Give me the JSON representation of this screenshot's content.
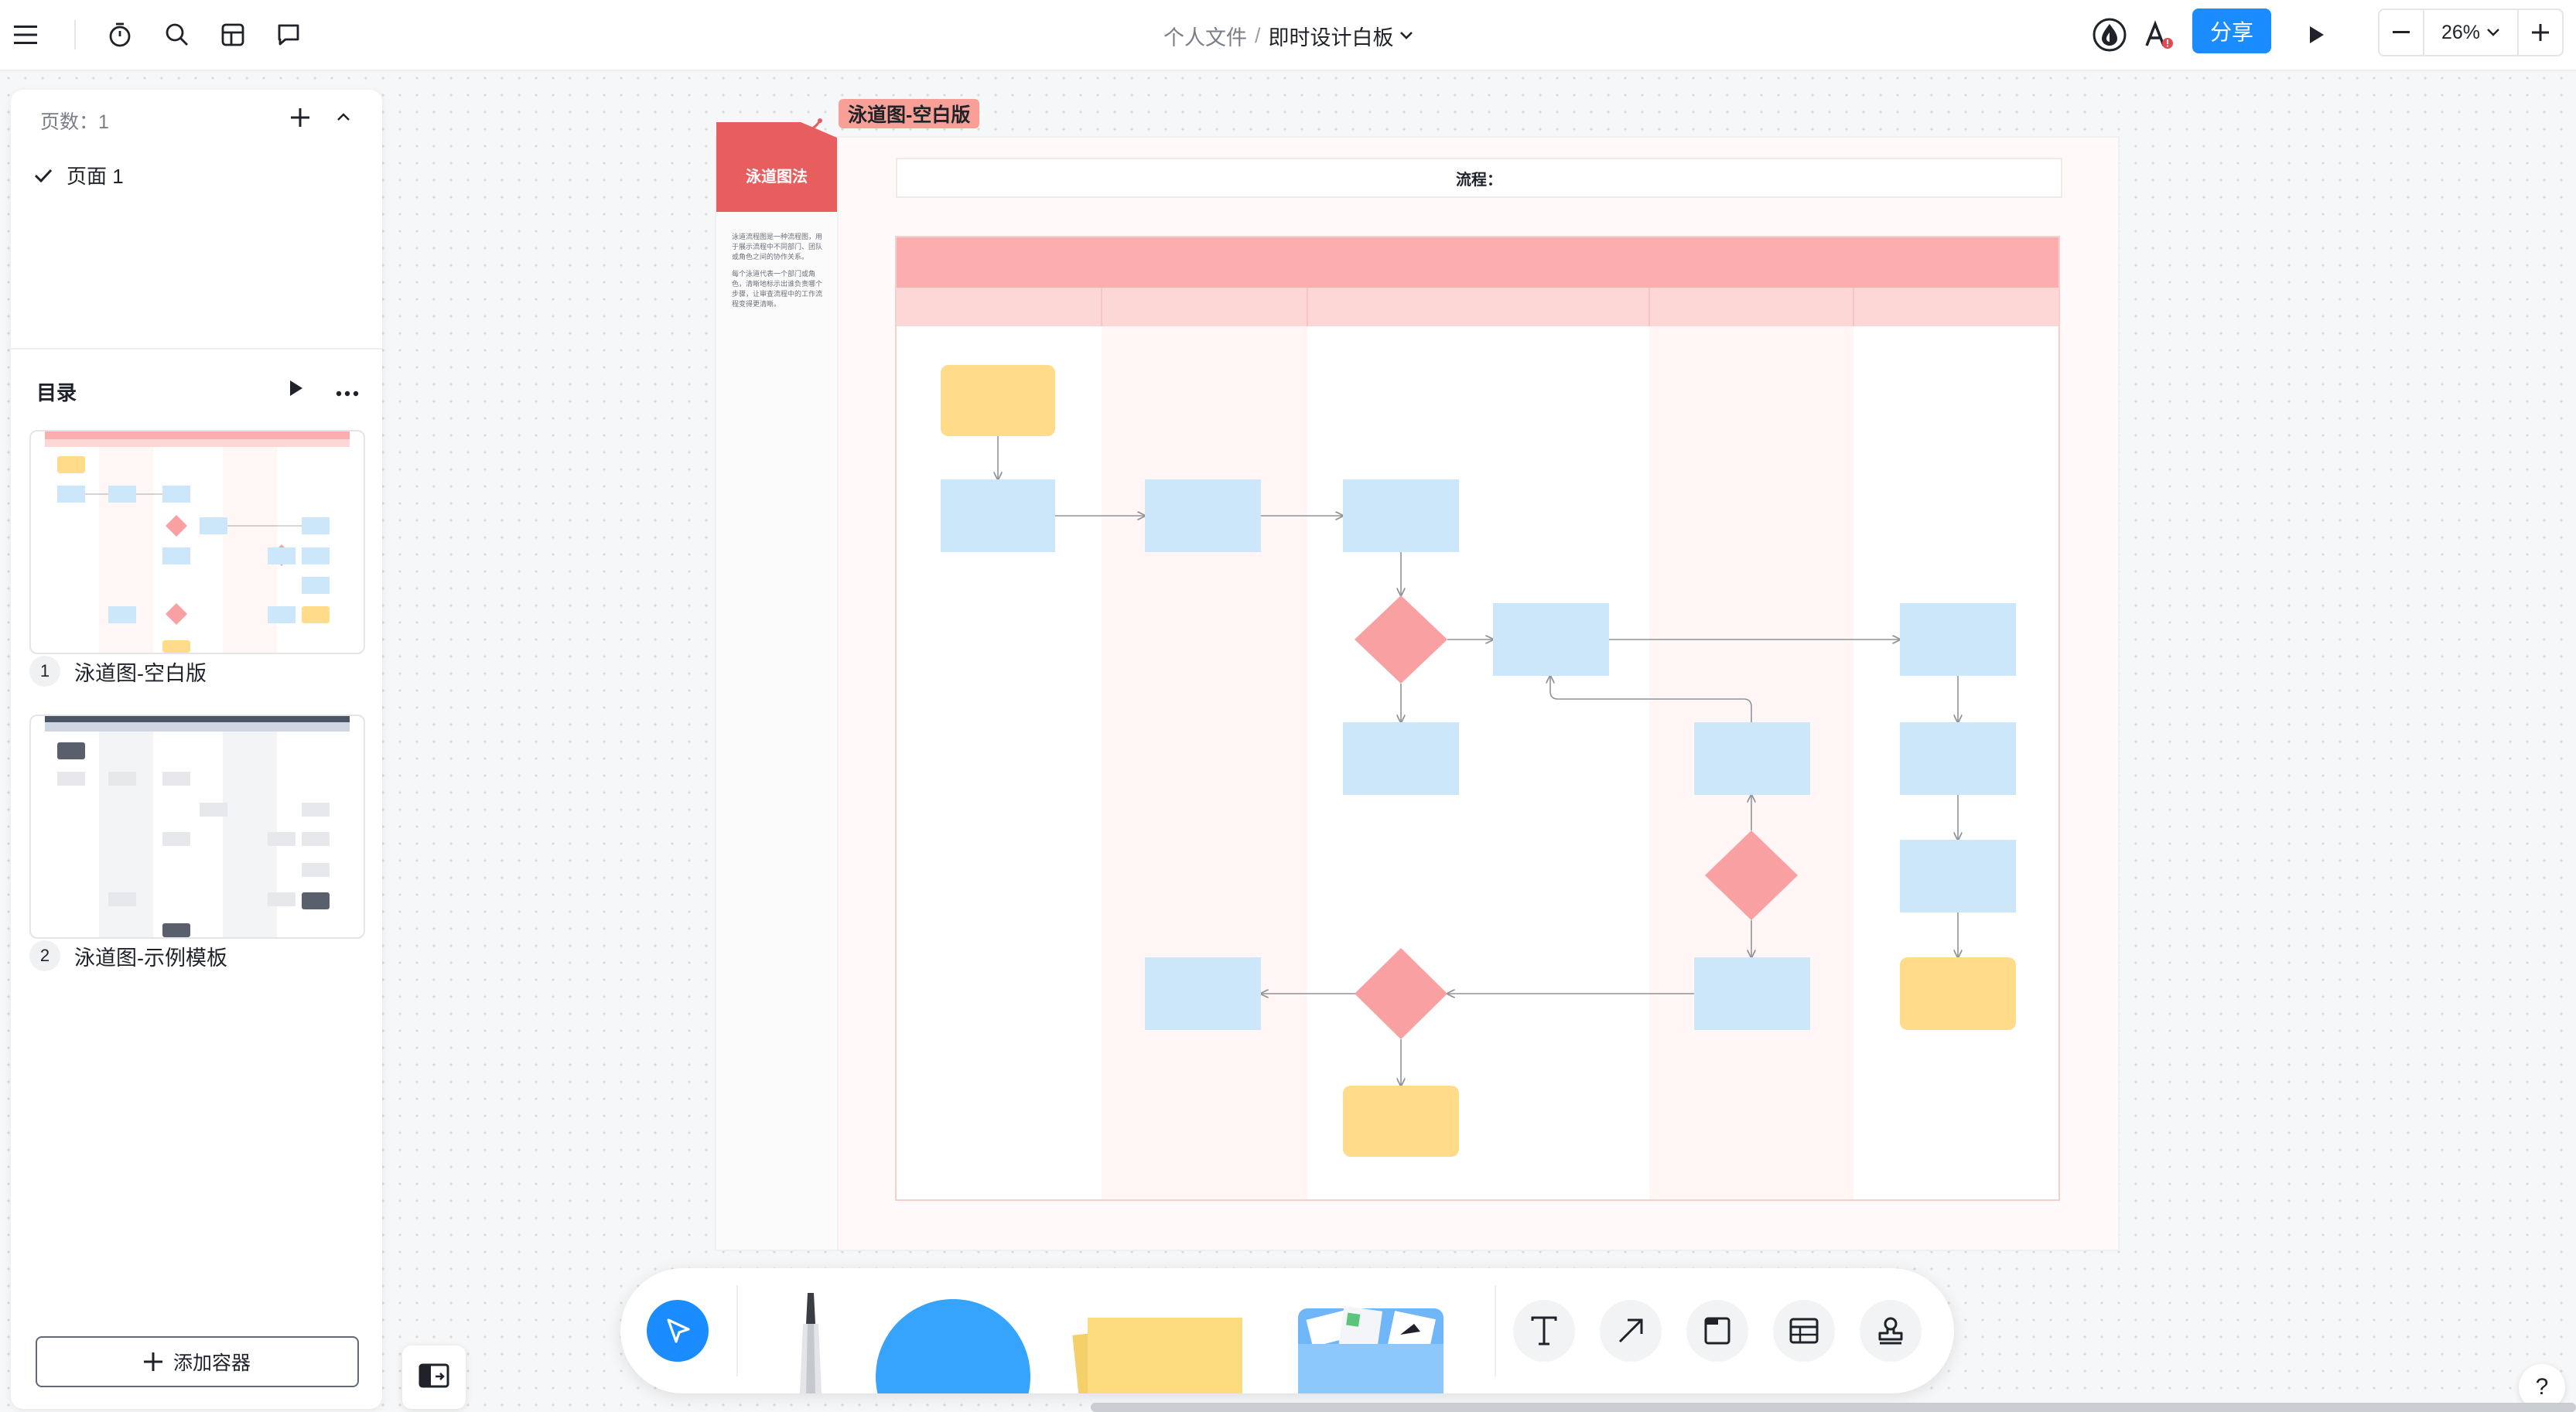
{
  "topbar": {
    "breadcrumb_folder": "个人文件",
    "breadcrumb_sep": "/",
    "doc_title": "即时设计白板",
    "share_label": "分享",
    "zoom_value": "26%",
    "zoom_minus": "−",
    "zoom_plus": "+"
  },
  "sidebar": {
    "pages_label": "页数：1",
    "pages": [
      {
        "label": "页面 1",
        "selected": true
      }
    ],
    "toc_label": "目录",
    "templates": [
      {
        "num": "1",
        "label": "泳道图-空白版"
      },
      {
        "num": "2",
        "label": "泳道图-示例模板"
      }
    ],
    "add_container_label": "添加容器"
  },
  "board": {
    "frame_label": "泳道图-空白版",
    "tab_title": "泳道图法",
    "desc_para1": "泳道流程图是一种流程图，用于展示流程中不同部门、团队或角色之间的协作关系。",
    "desc_para2": "每个泳道代表一个部门或角色，清晰地标示出谁负责哪个步骤，让审查流程中的工作流程变得更清晰。",
    "process_label": "流程：",
    "colors": {
      "header_band": "#fcaeae",
      "subheader_band": "#fdd6d6",
      "process": "#cce6fa",
      "terminal": "#ffdb8a",
      "decision": "#f9a0a3",
      "tab": "#e85d5d"
    }
  },
  "help_label": "?"
}
